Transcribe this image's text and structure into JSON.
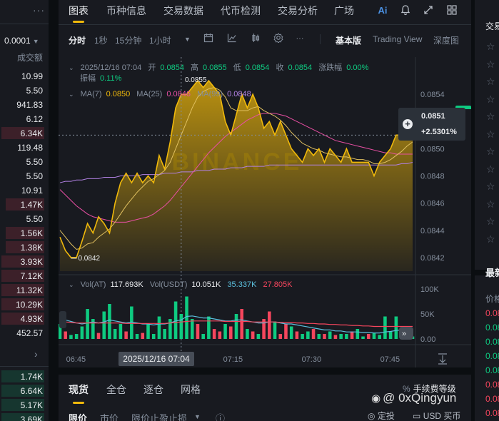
{
  "orderbook": {
    "precision": "0.0001",
    "column_header": "成交额",
    "asks": [
      {
        "v": "10.99",
        "depth": 0.0
      },
      {
        "v": "5.50",
        "depth": 0.0
      },
      {
        "v": "941.83",
        "depth": 0.0
      },
      {
        "v": "6.12",
        "depth": 0.0
      },
      {
        "v": "6.34K",
        "depth": 1.0
      },
      {
        "v": "119.48",
        "depth": 0.0
      },
      {
        "v": "5.50",
        "depth": 0.0
      },
      {
        "v": "5.50",
        "depth": 0.0
      },
      {
        "v": "10.91",
        "depth": 0.0
      },
      {
        "v": "1.47K",
        "depth": 0.9
      },
      {
        "v": "5.50",
        "depth": 0.0
      },
      {
        "v": "1.56K",
        "depth": 0.9
      },
      {
        "v": "1.38K",
        "depth": 0.9
      },
      {
        "v": "3.93K",
        "depth": 1.0
      },
      {
        "v": "7.12K",
        "depth": 1.0
      },
      {
        "v": "11.32K",
        "depth": 1.0
      },
      {
        "v": "10.29K",
        "depth": 1.0
      },
      {
        "v": "4.93K",
        "depth": 1.0
      },
      {
        "v": "452.57",
        "depth": 0.0
      }
    ],
    "bids": [
      {
        "v": "1.74K"
      },
      {
        "v": "6.64K"
      },
      {
        "v": "5.17K"
      },
      {
        "v": "3.69K"
      }
    ]
  },
  "tabs": [
    "图表",
    "币种信息",
    "交易数据",
    "代币检测",
    "交易分析",
    "广场"
  ],
  "top_icons": [
    "ai-icon",
    "bell-icon",
    "expand-icon",
    "layout-icon"
  ],
  "ai_label": "Ai",
  "toolbar": {
    "intervals": [
      "分时",
      "1秒",
      "15分钟",
      "1小时"
    ],
    "active": "分时",
    "views": [
      "基本版",
      "Trading View",
      "深度图"
    ],
    "active_view": "基本版"
  },
  "legend": {
    "date": "2025/12/16 07:04",
    "open_label": "开",
    "open": "0.0854",
    "high_label": "高",
    "high": "0.0855",
    "low_label": "低",
    "low": "0.0854",
    "close_label": "收",
    "close": "0.0854",
    "chg_label": "涨跌幅",
    "chg": "0.00%",
    "amp_label": "振幅",
    "amp": "0.11%",
    "ma_label": "MA(7)",
    "ma7": "0.0850",
    "ma25_label": "MA(25)",
    "ma25": "0.0846",
    "ma99_label": "MA(99)",
    "ma99": "0.0848",
    "vol_label": "Vol(AT)",
    "vol": "117.693K",
    "volusdt_label": "Vol(USDT)",
    "volusdt": "10.051K",
    "vol_ma1": "35.337K",
    "vol_ma2": "27.805K"
  },
  "price_box": {
    "price": "0.0851",
    "change": "+2.5301%"
  },
  "annotations": {
    "high": "0.0855",
    "low": "0.0842"
  },
  "price_axis_labels": [
    "0.0854",
    "0.0850",
    "0.0848",
    "0.0846",
    "0.0844",
    "0.0842"
  ],
  "vol_axis_labels": [
    "100K",
    "50K",
    "0.00"
  ],
  "time_axis_labels": [
    "06:45",
    "07:15",
    "07:30",
    "07:45"
  ],
  "crosshair_time": "2025/12/16 07:04",
  "watermark_text": "BINANCE",
  "bottom": {
    "tabs": [
      "现货",
      "全仓",
      "逐仓",
      "网格"
    ],
    "fee": "手续费等级",
    "order_types": [
      "限价",
      "市价",
      "限价止盈止损"
    ],
    "mini": [
      "定投",
      "USD 买币"
    ]
  },
  "right": {
    "title": "交易",
    "section": "最新",
    "sub": "价格",
    "prices": [
      {
        "v": "0.08",
        "c": "#f6465d"
      },
      {
        "v": "0.08",
        "c": "#0ecb81"
      },
      {
        "v": "0.08",
        "c": "#0ecb81"
      },
      {
        "v": "0.08",
        "c": "#0ecb81"
      },
      {
        "v": "0.08",
        "c": "#0ecb81"
      },
      {
        "v": "0.08",
        "c": "#f6465d"
      },
      {
        "v": "0.08",
        "c": "#f6465d"
      },
      {
        "v": "0.08",
        "c": "#f6465d"
      }
    ]
  },
  "credit": "@ 0xQingyun",
  "colors": {
    "up": "#0ecb81",
    "down": "#f6465d",
    "accent": "#f0b90b",
    "ma7": "#f0b90b",
    "ma25": "#e84fa3",
    "ma99": "#b181e3"
  },
  "chart_data": {
    "type": "area",
    "title": "",
    "x_start": "06:42",
    "x_step_minutes": 1,
    "price": [
      0.08435,
      0.08425,
      0.0842,
      0.0842,
      0.08432,
      0.08445,
      0.08438,
      0.0845,
      0.08445,
      0.08438,
      0.0846,
      0.08475,
      0.08482,
      0.08475,
      0.08482,
      0.08475,
      0.0848,
      0.08475,
      0.08495,
      0.08485,
      0.08505,
      0.0853,
      0.0854,
      0.0854,
      0.08545,
      0.0855,
      0.08545,
      0.0855,
      0.08545,
      0.0854,
      0.0852,
      0.0851,
      0.08525,
      0.0854,
      0.0853,
      0.0854,
      0.0853,
      0.08515,
      0.0852,
      0.0851,
      0.0852,
      0.0851,
      0.085,
      0.08495,
      0.0849,
      0.085,
      0.08495,
      0.085,
      0.0849,
      0.085,
      0.08495,
      0.0849,
      0.085,
      0.0849,
      0.0849,
      0.0849,
      0.0849,
      0.0848,
      0.0849,
      0.08495,
      0.085,
      0.0851,
      0.0851,
      0.0851,
      0.0851
    ],
    "ma7": [
      0.0844,
      0.08435,
      0.0843,
      0.08426,
      0.08427,
      0.0843,
      0.08431,
      0.08435,
      0.08438,
      0.08441,
      0.08446,
      0.08452,
      0.08458,
      0.08463,
      0.08468,
      0.08472,
      0.08476,
      0.08478,
      0.08481,
      0.08484,
      0.0849,
      0.085,
      0.0851,
      0.0852,
      0.0853,
      0.08538,
      0.08542,
      0.08544,
      0.08545,
      0.08543,
      0.08538,
      0.0853,
      0.08528,
      0.08528,
      0.08528,
      0.0853,
      0.08531,
      0.08528,
      0.08526,
      0.08524,
      0.08521,
      0.08517,
      0.08512,
      0.08508,
      0.08504,
      0.08502,
      0.085,
      0.08499,
      0.08497,
      0.08496,
      0.08495,
      0.08494,
      0.08494,
      0.08493,
      0.08492,
      0.08492,
      0.08491,
      0.08489,
      0.08489,
      0.0849,
      0.08492,
      0.08495,
      0.08498,
      0.08502,
      0.08505
    ],
    "ma25": [
      0.0847,
      0.08466,
      0.08462,
      0.08458,
      0.08455,
      0.08452,
      0.0845,
      0.08449,
      0.08448,
      0.08447,
      0.08446,
      0.08446,
      0.08446,
      0.08447,
      0.08448,
      0.08449,
      0.0845,
      0.08452,
      0.08455,
      0.08458,
      0.08462,
      0.08467,
      0.08472,
      0.08477,
      0.08482,
      0.08487,
      0.08492,
      0.08497,
      0.08501,
      0.08505,
      0.08509,
      0.08512,
      0.08515,
      0.08518,
      0.08521,
      0.08523,
      0.08525,
      0.08526,
      0.08526,
      0.08526,
      0.08525,
      0.08524,
      0.08522,
      0.0852,
      0.08518,
      0.08516,
      0.08514,
      0.08512,
      0.0851,
      0.08508,
      0.08506,
      0.08505,
      0.08504,
      0.08503,
      0.08502,
      0.08501,
      0.085,
      0.08499,
      0.08498,
      0.08497,
      0.08497,
      0.08496,
      0.08496,
      0.08496,
      0.08496
    ],
    "ma99": [
      0.08475,
      0.08476,
      0.08476,
      0.08477,
      0.08477,
      0.08478,
      0.08478,
      0.08478,
      0.08479,
      0.08479,
      0.08479,
      0.0848,
      0.0848,
      0.0848,
      0.0848,
      0.08481,
      0.08481,
      0.08481,
      0.08481,
      0.08482,
      0.08482,
      0.08482,
      0.08483,
      0.08483,
      0.08483,
      0.08484,
      0.08484,
      0.08484,
      0.08485,
      0.08485,
      0.08485,
      0.08486,
      0.08486,
      0.08486,
      0.08487,
      0.08487,
      0.08487,
      0.08487,
      0.08488,
      0.08488,
      0.08488,
      0.08488,
      0.08488,
      0.08488,
      0.08488,
      0.08488,
      0.08488,
      0.08488,
      0.08488,
      0.08488,
      0.08488,
      0.08488,
      0.08488,
      0.08488,
      0.08488,
      0.08488,
      0.08488,
      0.08488,
      0.08488,
      0.08488,
      0.08488,
      0.08488,
      0.08489,
      0.08489,
      0.0849
    ],
    "volume": [
      30,
      15,
      8,
      10,
      25,
      60,
      40,
      12,
      55,
      70,
      20,
      30,
      15,
      65,
      10,
      12,
      30,
      10,
      45,
      20,
      40,
      75,
      50,
      85,
      40,
      30,
      10,
      45,
      20,
      15,
      30,
      25,
      50,
      60,
      20,
      15,
      10,
      40,
      55,
      35,
      10,
      30,
      25,
      15,
      10,
      15,
      20,
      10,
      10,
      15,
      8,
      10,
      10,
      15,
      20,
      5,
      10,
      12,
      8,
      45,
      15,
      45,
      20,
      10,
      5
    ],
    "volume_dir": [
      "g",
      "r",
      "g",
      "g",
      "g",
      "g",
      "g",
      "r",
      "g",
      "g",
      "g",
      "g",
      "r",
      "g",
      "g",
      "r",
      "g",
      "g",
      "g",
      "g",
      "g",
      "g",
      "g",
      "g",
      "g",
      "r",
      "g",
      "g",
      "r",
      "r",
      "g",
      "r",
      "g",
      "r",
      "g",
      "r",
      "g",
      "r",
      "r",
      "g",
      "r",
      "r",
      "g",
      "r",
      "g",
      "g",
      "r",
      "g",
      "r",
      "g",
      "r",
      "g",
      "g",
      "r",
      "g",
      "g",
      "r",
      "g",
      "g",
      "g",
      "g",
      "g",
      "g",
      "g",
      "g"
    ],
    "vol_ma1": [
      40,
      38,
      35,
      32,
      30,
      32,
      34,
      32,
      34,
      38,
      36,
      34,
      32,
      34,
      32,
      30,
      30,
      28,
      30,
      30,
      32,
      36,
      38,
      45,
      46,
      44,
      42,
      42,
      40,
      38,
      36,
      36,
      38,
      38,
      36,
      34,
      32,
      32,
      34,
      34,
      32,
      30,
      30,
      28,
      26,
      24,
      22,
      20,
      18,
      18,
      16,
      16,
      14,
      14,
      14,
      13,
      13,
      12,
      12,
      14,
      15,
      17,
      18,
      16,
      15
    ],
    "vol_ma2": [
      35,
      34,
      33,
      32,
      32,
      32,
      32,
      32,
      32,
      32,
      32,
      32,
      31,
      31,
      31,
      31,
      31,
      31,
      31,
      31,
      32,
      33,
      34,
      35,
      36,
      36,
      36,
      36,
      36,
      36,
      35,
      35,
      35,
      35,
      35,
      34,
      34,
      34,
      34,
      34,
      33,
      33,
      33,
      32,
      32,
      31,
      31,
      30,
      30,
      29,
      29,
      28,
      28,
      27,
      27,
      26,
      26,
      25,
      25,
      25,
      25,
      25,
      25,
      25,
      25
    ],
    "ylim": [
      0.0841,
      0.0856
    ],
    "vol_ylim": [
      0,
      110
    ]
  }
}
